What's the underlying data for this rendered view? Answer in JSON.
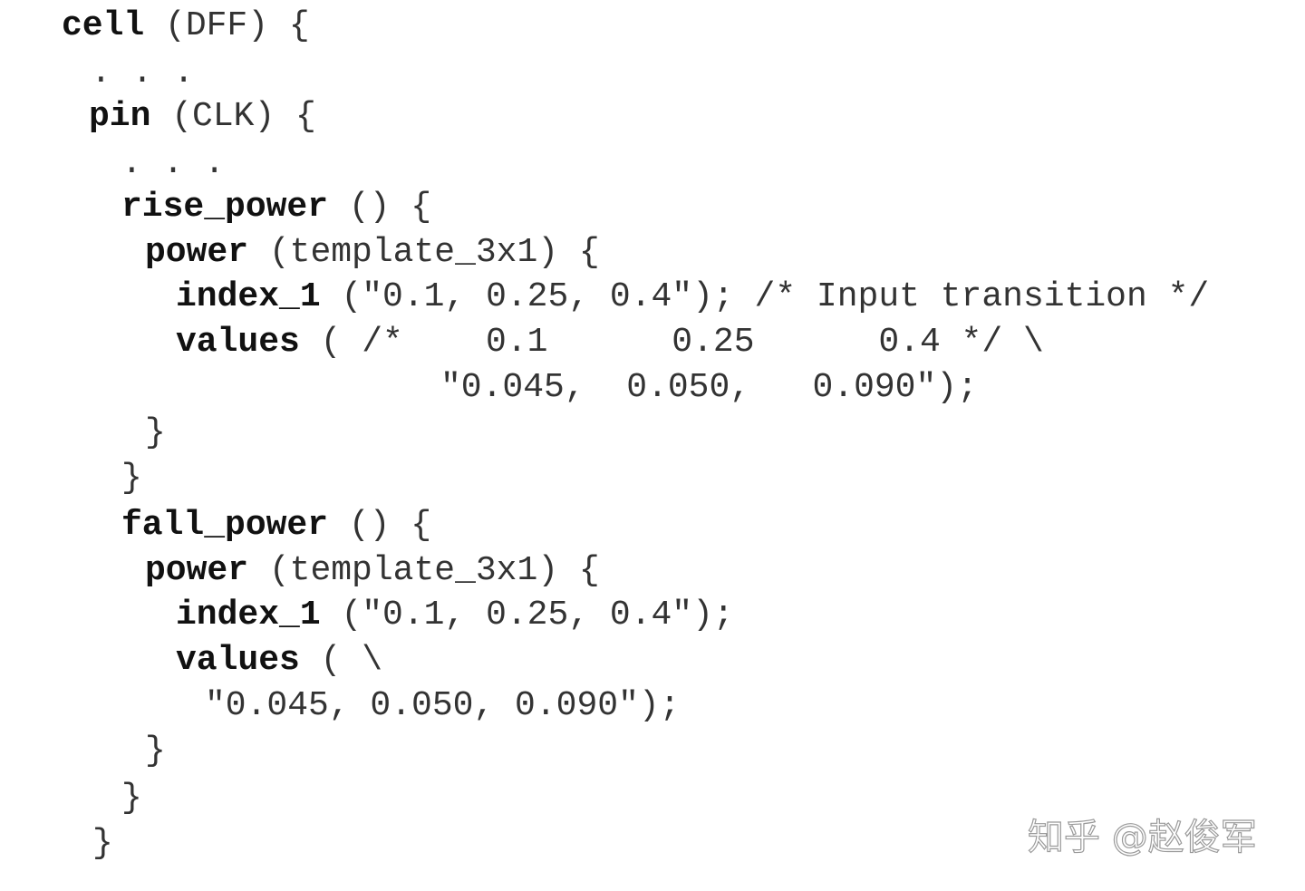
{
  "code": {
    "line1": {
      "kw": "cell",
      "rest": " (DFF) {"
    },
    "line2": {
      "rest": ". . ."
    },
    "line3": {
      "kw": "pin",
      "rest": " (CLK) {"
    },
    "line4": {
      "rest": ". . ."
    },
    "line5": {
      "kw": "rise_power",
      "rest": " () {"
    },
    "line6": {
      "kw": "power",
      "rest": " (template_3x1) {"
    },
    "line7": {
      "kw": "index_1",
      "rest": " (\"0.1, 0.25, 0.4\"); /* Input transition */"
    },
    "line8": {
      "kw": "values",
      "rest": " ( /*    0.1      0.25      0.4 */ \\"
    },
    "line9": {
      "rest": "\"0.045,  0.050,   0.090\");"
    },
    "line10": {
      "rest": "}"
    },
    "line11": {
      "rest": "}"
    },
    "line12": {
      "kw": "fall_power",
      "rest": " () {"
    },
    "line13": {
      "kw": "power",
      "rest": " (template_3x1) {"
    },
    "line14": {
      "kw": "index_1",
      "rest": " (\"0.1, 0.25, 0.4\");"
    },
    "line15": {
      "kw": "values",
      "rest": " ( \\"
    },
    "line16": {
      "rest": "\"0.045, 0.050, 0.090\");"
    },
    "line17": {
      "rest": "}"
    },
    "line18": {
      "rest": "}"
    },
    "line19": {
      "rest": "}"
    }
  },
  "watermark": "知乎 @赵俊军"
}
